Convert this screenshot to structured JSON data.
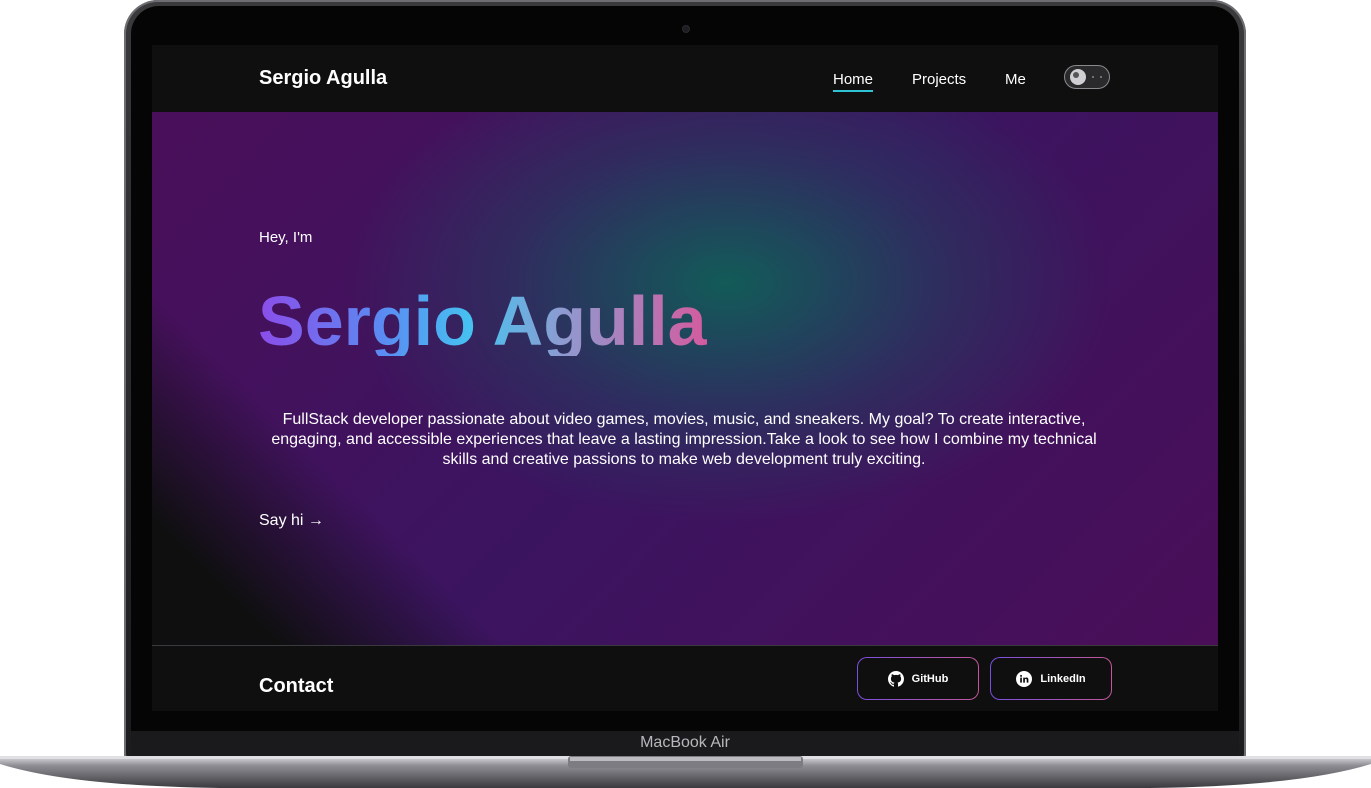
{
  "device": {
    "brand_label": "MacBook Air"
  },
  "nav": {
    "logo": "Sergio Agulla",
    "links": [
      "Home",
      "Projects",
      "Me"
    ],
    "active": "Home",
    "theme_toggle_icon": "moon-icon"
  },
  "hero": {
    "greeting": "Hey, I'm",
    "name": "Sergio Agulla",
    "bio": "FullStack developer passionate about video games, movies, music, and sneakers. My goal? To create interactive, engaging, and accessible experiences that leave a lasting impression.Take a look to see how I combine my technical skills and creative passions to make web development truly exciting.",
    "cta": "Say hi →"
  },
  "footer": {
    "title": "Contact",
    "github_label": "GitHub",
    "github_icon": "github-icon",
    "linkedin_label": "LinkedIn",
    "linkedin_icon": "linkedin-icon"
  },
  "colors": {
    "accent": "#2ec4d6",
    "name_gradient": [
      "#8b4dea",
      "#45c3f0",
      "#d45b9e"
    ],
    "hero_purple": "#4a0f5a",
    "hero_teal": "#105f58",
    "background": "#0f0f0f"
  }
}
